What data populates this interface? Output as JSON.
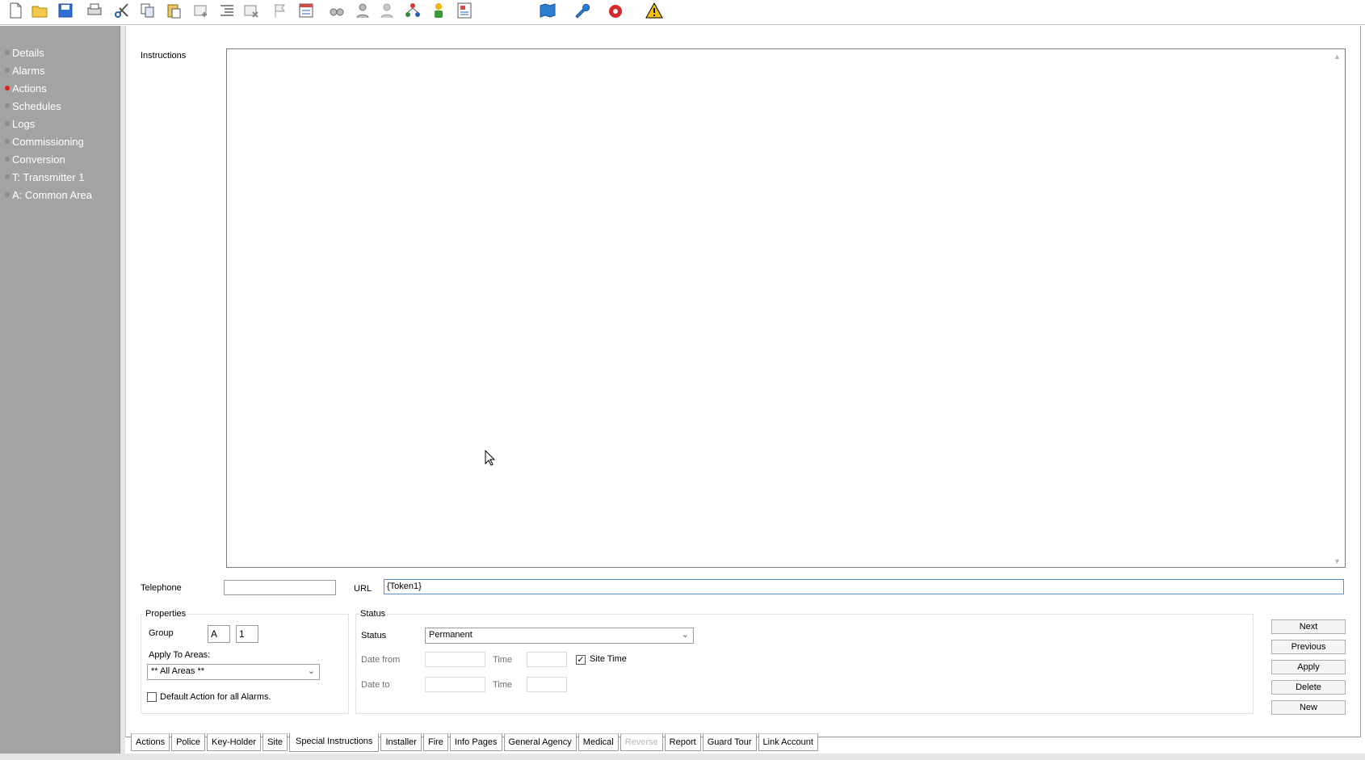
{
  "toolbar": {
    "icons": [
      "new-file-icon",
      "open-folder-icon",
      "save-icon",
      "print-icon",
      "cut-icon",
      "copy-icon",
      "paste-icon",
      "add-record-icon",
      "indent-icon",
      "delete-record-icon",
      "flag-icon",
      "form-icon",
      "binoculars-icon",
      "person-search-icon",
      "person-search-alt-icon",
      "tree-icon",
      "keyholder-icon",
      "report-icon",
      "map-icon",
      "wrench-icon",
      "alarm-bell-icon",
      "warning-icon"
    ]
  },
  "sidebar": {
    "items": [
      {
        "label": "Details",
        "active": false
      },
      {
        "label": "Alarms",
        "active": false
      },
      {
        "label": "Actions",
        "active": true
      },
      {
        "label": "Schedules",
        "active": false
      },
      {
        "label": "Logs",
        "active": false
      },
      {
        "label": "Commissioning",
        "active": false
      },
      {
        "label": "Conversion",
        "active": false
      },
      {
        "label": "T: Transmitter 1",
        "active": false
      },
      {
        "label": "A: Common Area",
        "active": false
      }
    ]
  },
  "form": {
    "instructions_label": "Instructions",
    "instructions_value": "",
    "telephone_label": "Telephone",
    "telephone_value": "",
    "url_label": "URL",
    "url_value": "{Token1}"
  },
  "properties": {
    "title": "Properties",
    "group_label": "Group",
    "group_letter": "A",
    "group_number": "1",
    "apply_to_areas_label": "Apply To Areas:",
    "apply_to_areas_value": "** All Areas **",
    "default_action_label": "Default Action for all Alarms.",
    "default_action_checked": false
  },
  "status": {
    "title": "Status",
    "status_label": "Status",
    "status_value": "Permanent",
    "date_from_label": "Date from",
    "date_to_label": "Date to",
    "time_label_1": "Time",
    "time_label_2": "Time",
    "site_time_label": "Site Time",
    "site_time_checked": true
  },
  "buttons": {
    "next": "Next",
    "previous": "Previous",
    "apply": "Apply",
    "delete": "Delete",
    "new": "New"
  },
  "tabs": [
    {
      "label": "Actions",
      "state": "normal"
    },
    {
      "label": "Police",
      "state": "normal"
    },
    {
      "label": "Key-Holder",
      "state": "normal"
    },
    {
      "label": "Site",
      "state": "normal"
    },
    {
      "label": "Special Instructions",
      "state": "active"
    },
    {
      "label": "Installer",
      "state": "normal"
    },
    {
      "label": "Fire",
      "state": "normal"
    },
    {
      "label": "Info Pages",
      "state": "normal"
    },
    {
      "label": "General Agency",
      "state": "normal"
    },
    {
      "label": "Medical",
      "state": "normal"
    },
    {
      "label": "Reverse",
      "state": "disabled"
    },
    {
      "label": "Report",
      "state": "normal"
    },
    {
      "label": "Guard Tour",
      "state": "normal"
    },
    {
      "label": "Link Account",
      "state": "normal"
    }
  ],
  "colors": {
    "sidebar_bg": "#a3a3a3",
    "active_dot": "#e02020",
    "url_border": "#5a8fd6"
  }
}
